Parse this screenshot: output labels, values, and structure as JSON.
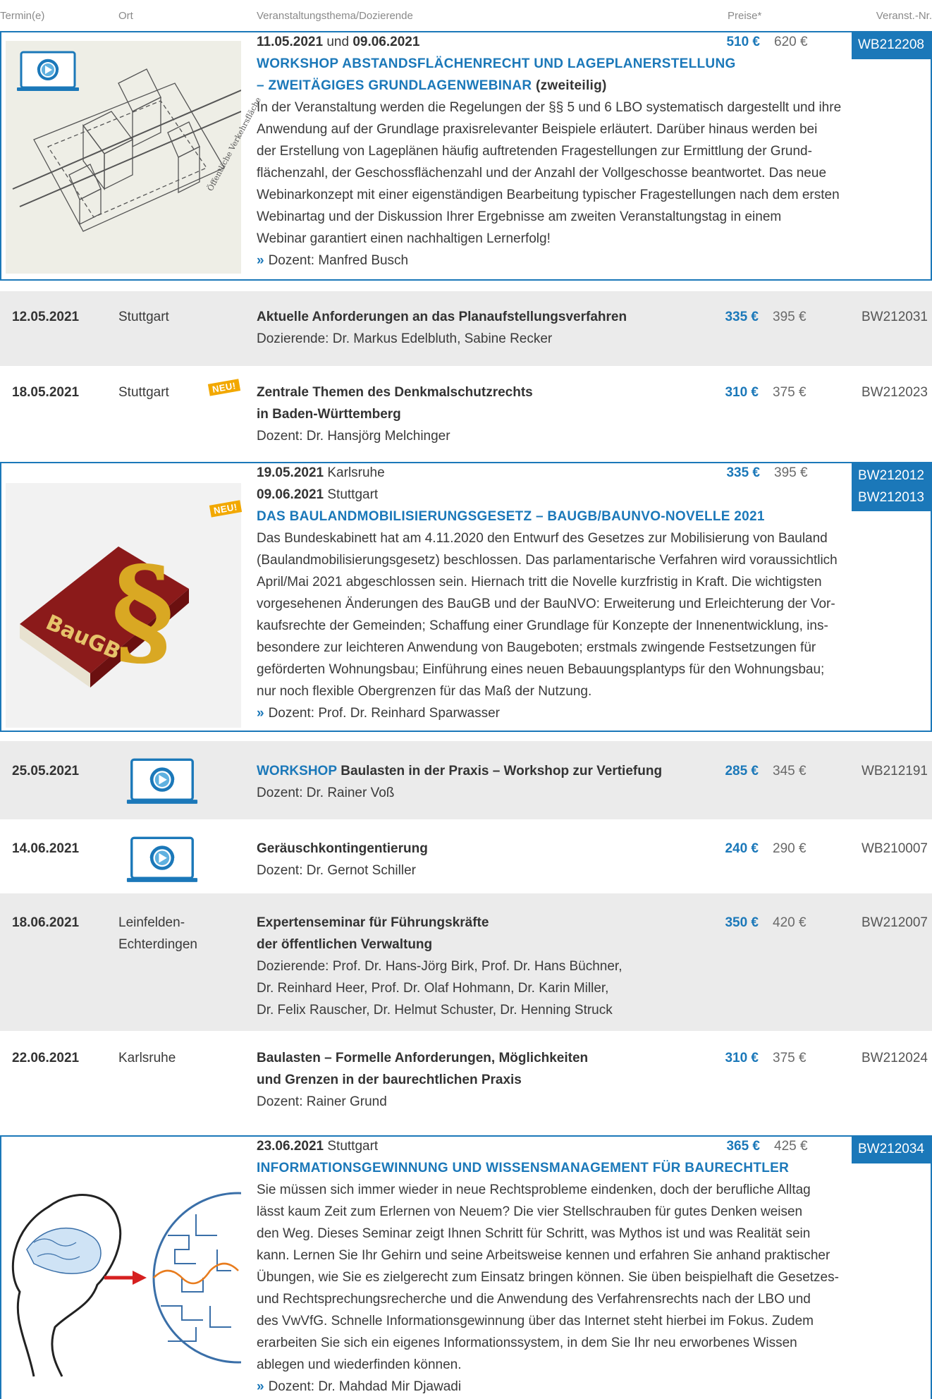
{
  "header": {
    "termin": "Termin(e)",
    "ort": "Ort",
    "thema": "Veranstaltungsthema/Dozierende",
    "preise": "Preise*",
    "nr": "Veranst.-Nr."
  },
  "entries": [
    {
      "dates_1": "11.05.2021",
      "und": " und ",
      "dates_2": "09.06.2021",
      "price_members": "510 €",
      "price_regular": "620 €",
      "number": "WB212208",
      "title_prefix": "WORKSHOP",
      "title": " ABSTANDSFLÄCHENRECHT UND LAGEPLANERSTELLUNG",
      "title_line2": "– ZWEITÄGIGES GRUNDLAGENWEBINAR",
      "title_suffix": " (zweiteilig)",
      "description": [
        "In der Veranstaltung werden die Regelungen der §§ 5 und 6 LBO systematisch dargestellt und ihre",
        "Anwendung auf der Grundlage praxisrelevanter Beispiele erläutert. Darüber hinaus werden bei",
        "der Erstellung von Lageplänen häufig auftretenden Fragestellungen zur Ermittlung der Grund-",
        "flächenzahl, der Geschossflächenzahl und der Anzahl der Vollgeschosse beantwortet. Das neue",
        "Webinarkonzept mit einer eigenständigen Bearbeitung typischer Fragestellungen nach dem ersten",
        "Webinartag und der Diskussion Ihrer Ergebnisse am zweiten Veranstaltungstag in einem",
        "Webinar garantiert einen nachhaltigen Lernerfolg!"
      ],
      "speaker": "Dozent: Manfred Busch",
      "image_text": "Öffentliche Verkehrsfläche"
    },
    {
      "date": "12.05.2021",
      "place": "Stuttgart",
      "title": "Aktuelle Anforderungen an das Planaufstellungsverfahren",
      "speaker": "Dozierende: Dr. Markus Edelbluth, Sabine Recker",
      "price_members": "335 €",
      "price_regular": "395 €",
      "number": "BW212031"
    },
    {
      "date": "18.05.2021",
      "place": "Stuttgart",
      "badge": "NEU!",
      "title_1": "Zentrale Themen des Denkmalschutzrechts",
      "title_2": "in Baden-Württemberg",
      "speaker": "Dozent: Dr. Hansjörg Melchinger",
      "price_members": "310 €",
      "price_regular": "375 €",
      "number": "BW212023"
    },
    {
      "date_1": "19.05.2021",
      "place_1": " Karlsruhe",
      "date_2": "09.06.2021",
      "place_2": " Stuttgart",
      "badge": "NEU!",
      "number_1": "BW212012",
      "number_2": "BW212013",
      "price_members": "335 €",
      "price_regular": "395 €",
      "title": "DAS BAULANDMOBILISIERUNGSGESETZ – BAUGB/BAUNVO-NOVELLE 2021",
      "description": [
        "Das Bundeskabinett hat am 4.11.2020 den Entwurf des Gesetzes zur Mobilisierung von Bauland",
        "(Baulandmobilisierungsgesetz) beschlossen. Das parlamentarische Verfahren wird voraussichtlich",
        "April/Mai 2021 abgeschlossen sein. Hiernach tritt die Novelle kurzfristig in Kraft. Die wichtigsten",
        "vorgesehenen Änderungen des BauGB und der BauNVO: Erweiterung und Erleichterung der Vor-",
        "kaufsrechte der Gemeinden; Schaffung einer Grundlage für Konzepte der Innenentwicklung, ins-",
        "besondere zur leichteren Anwendung von Baugeboten; erstmals zwingende Festsetzungen für",
        "geförderten Wohnungsbau; Einführung eines neuen Bebauungsplantyps für den Wohnungsbau;",
        "nur noch flexible Obergrenzen für das Maß der Nutzung."
      ],
      "speaker": "Dozent: Prof. Dr. Reinhard Sparwasser",
      "image_text": "BauGB"
    },
    {
      "date": "25.05.2021",
      "title_prefix": "WORKSHOP",
      "title": " Baulasten in der Praxis – Workshop zur Vertiefung",
      "speaker": "Dozent: Dr. Rainer Voß",
      "price_members": "285 €",
      "price_regular": "345 €",
      "number": "WB212191"
    },
    {
      "date": "14.06.2021",
      "title": "Geräuschkontingentierung",
      "speaker": "Dozent: Dr. Gernot Schiller",
      "price_members": "240 €",
      "price_regular": "290 €",
      "number": "WB210007"
    },
    {
      "date": "18.06.2021",
      "place_1": "Leinfelden-",
      "place_2": "Echterdingen",
      "title_1": "Expertenseminar für Führungskräfte",
      "title_2": "der öffentlichen Verwaltung",
      "speakers": [
        "Dozierende: Prof. Dr. Hans-Jörg Birk, Prof. Dr. Hans Büchner,",
        "Dr. Reinhard Heer, Prof. Dr. Olaf Hohmann, Dr. Karin Miller,",
        "Dr. Felix Rauscher, Dr. Helmut Schuster, Dr. Henning Struck"
      ],
      "price_members": "350 €",
      "price_regular": "420 €",
      "number": "BW212007"
    },
    {
      "date": "22.06.2021",
      "place": "Karlsruhe",
      "title_1": "Baulasten – Formelle Anforderungen, Möglichkeiten",
      "title_2": "und Grenzen in der baurechtlichen Praxis",
      "speaker": "Dozent: Rainer Grund",
      "price_members": "310 €",
      "price_regular": "375 €",
      "number": "BW212024"
    },
    {
      "date": "23.06.2021",
      "place": " Stuttgart",
      "price_members": "365 €",
      "price_regular": "425 €",
      "number": "BW212034",
      "title": "INFORMATIONSGEWINNUNG UND WISSENSMANAGEMENT FÜR BAURECHTLER",
      "description": [
        "Sie müssen sich immer wieder in neue Rechtsprobleme eindenken, doch der berufliche Alltag",
        "lässt kaum Zeit zum Erlernen von Neuem? Die vier Stellschrauben für gutes Denken weisen",
        "den Weg. Dieses Seminar zeigt Ihnen Schritt für Schritt, was Mythos ist und was Realität sein",
        "kann. Lernen Sie Ihr Gehirn und seine Arbeitsweise kennen und erfahren Sie anhand praktischer",
        "Übungen, wie Sie es zielgerecht zum Einsatz bringen können. Sie üben beispielhaft die Gesetzes-",
        "und Rechtsprechungsrecherche und die Anwendung des Verfahrensrechts nach der LBO und",
        "des VwVfG. Schnelle Informationsgewinnung über das Internet steht hierbei im Fokus. Zudem",
        "erarbeiten Sie sich ein eigenes Informationssystem, in dem Sie Ihr neu erworbenes Wissen",
        "ablegen und wiederfinden können."
      ],
      "speaker": "Dozent: Dr. Mahdad Mir Djawadi"
    }
  ],
  "icons": {
    "webinar": "webinar-laptop-icon",
    "arrow": "»"
  },
  "colors": {
    "accent": "#1b78b9",
    "badge_new": "#f2a800",
    "row_grey": "#ebebeb"
  }
}
